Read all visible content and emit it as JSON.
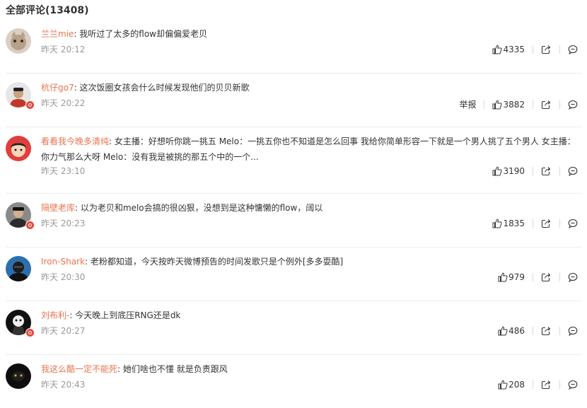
{
  "header": {
    "title": "全部评论(13408)"
  },
  "comments": [
    {
      "user": "兰兰mie",
      "text": "我听过了太多的flow却偏偏爱老贝",
      "time": "昨天 20:12",
      "likes": "4335"
    },
    {
      "user": "杭仔go7",
      "text": "这次饭圈女孩会什么时候发现他们的贝贝新歌",
      "time": "昨天 20:22",
      "likes": "3882",
      "report": "举报"
    },
    {
      "user": "看看我今晚多清纯",
      "text": "女主播：好想听你跳一挑五 Melo：一挑五你也不知道是怎么回事 我给你简单形容一下就是一个男人挑了五个男人 女主播：你力气那么大呀 Melo：没有我是被挑的那五个中的一个...",
      "time": "昨天 23:10",
      "likes": "3190"
    },
    {
      "user": "隔壁老库",
      "text": "以为老贝和melo会搞的很凶狠，没想到是这种慵懒的flow，阔以",
      "time": "昨天 20:23",
      "likes": "1835"
    },
    {
      "user": "Iron-Shark",
      "text": "老粉都知道，今天按昨天微博预告的时间发歌只是个例外[多多耍酷]",
      "time": "昨天 20:30",
      "likes": "979"
    },
    {
      "user": "刘布利-",
      "text": "今天晚上到底压RNG还是dk",
      "time": "昨天 20:27",
      "likes": "486"
    },
    {
      "user": "我这么酷一定不能死",
      "text": "她们啥也不懂 就是负责跟风",
      "time": "昨天 20:43",
      "likes": "208"
    }
  ],
  "colors": {
    "username": "#eb7350",
    "time": "#999999",
    "text": "#333333",
    "badge": "#e8483b"
  }
}
